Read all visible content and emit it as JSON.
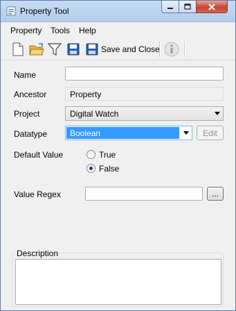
{
  "window": {
    "title": "Property Tool"
  },
  "menu": {
    "property": "Property",
    "tools": "Tools",
    "help": "Help"
  },
  "toolbar": {
    "save_close_label": "Save and Close"
  },
  "form": {
    "name_label": "Name",
    "name_value": "",
    "ancestor_label": "Ancestor",
    "ancestor_value": "Property",
    "project_label": "Project",
    "project_value": "Digital Watch",
    "datatype_label": "Datatype",
    "datatype_value": "Boolean",
    "edit_button": "Edit",
    "default_value_label": "Default Value",
    "radio_true": "True",
    "radio_false": "False",
    "selected_default": "False",
    "value_regex_label": "Value Regex",
    "value_regex_value": "",
    "browse_button": "...",
    "description_label": "Description",
    "description_value": ""
  },
  "colors": {
    "selection": "#3399ff",
    "titlebar": "#b3cdea",
    "close": "#c7432f"
  }
}
